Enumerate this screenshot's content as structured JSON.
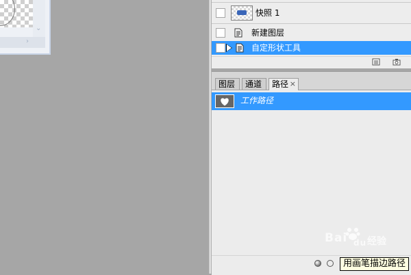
{
  "history": {
    "snapshot_label": "快照 1",
    "steps": [
      {
        "label": "新建图层",
        "selected": false
      },
      {
        "label": "自定形状工具",
        "selected": true
      }
    ]
  },
  "paths_panel": {
    "tabs": [
      {
        "label": "图层",
        "active": false
      },
      {
        "label": "通道",
        "active": false
      },
      {
        "label": "路径",
        "active": true
      }
    ],
    "close_glyph": "×",
    "paths": [
      {
        "name": "工作路径",
        "selected": true
      }
    ],
    "tooltip": "用画笔描边路径"
  },
  "watermark": {
    "brand": "Bai",
    "brand_suffix": "du",
    "sub": "经验"
  },
  "colors": {
    "selection": "#3399ff",
    "workspace": "#a6a6a6",
    "panel": "#ececec",
    "tooltip_bg": "#ffffe1"
  }
}
